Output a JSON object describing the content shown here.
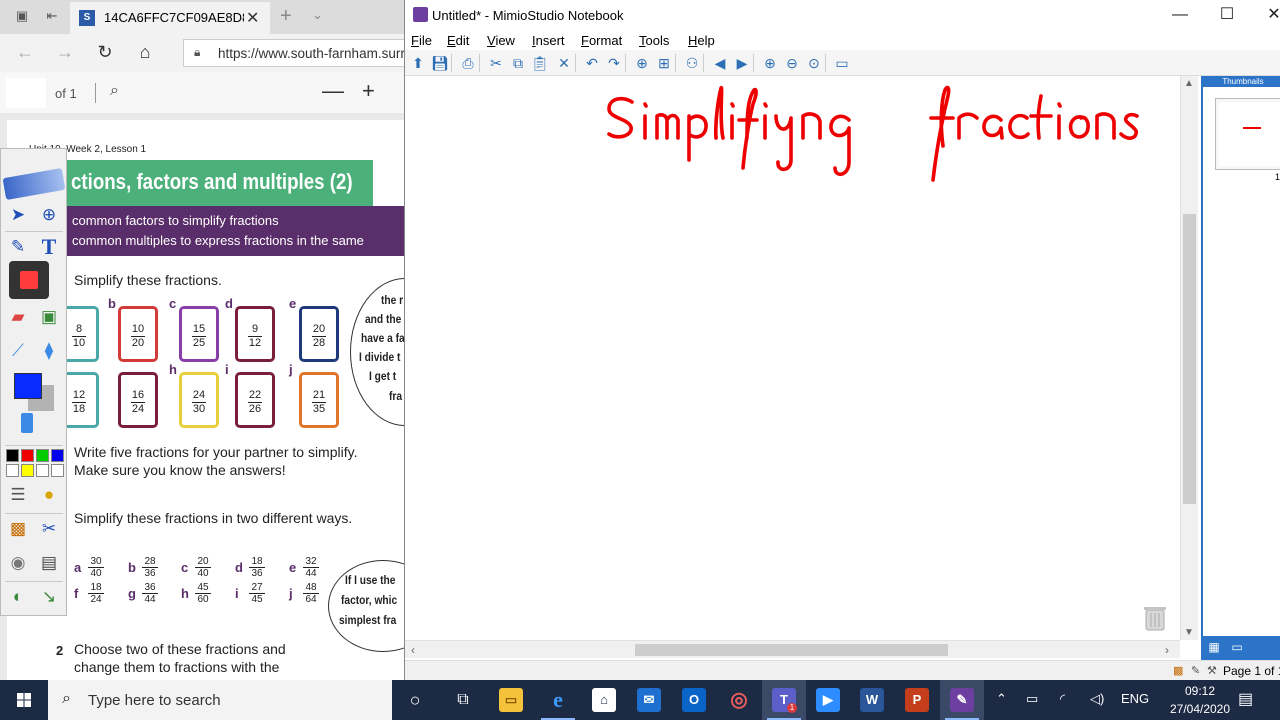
{
  "browser": {
    "tab_title": "14CA6FFC7CF09AE8D8I",
    "tab_favicon": "S",
    "url": "https://www.south-farnham.surr",
    "icons": {
      "back": "back-arrow-icon",
      "forward": "forward-arrow-icon",
      "refresh": "refresh-icon",
      "home": "home-icon",
      "lock": "lock-icon"
    },
    "pdf": {
      "page_of": "of 1",
      "unit": "Unit 10, Week 2, Lesson 1",
      "banner_title": "ctions, factors and multiples (2)",
      "objective_1": "common factors to simplify fractions",
      "objective_2": "common multiples to express fractions in the same",
      "q1_text": "Simplify these fractions.",
      "cards_row1": [
        {
          "letter": "",
          "num": "8",
          "den": "10",
          "color": "#4aa8a8"
        },
        {
          "letter": "b",
          "num": "10",
          "den": "20",
          "color": "#d33b3b"
        },
        {
          "letter": "c",
          "num": "15",
          "den": "25",
          "color": "#8a3fa8"
        },
        {
          "letter": "d",
          "num": "9",
          "den": "12",
          "color": "#7a1f3a"
        },
        {
          "letter": "e",
          "num": "20",
          "den": "28",
          "color": "#1f3a7a"
        }
      ],
      "cards_row2": [
        {
          "letter": "g",
          "num": "12",
          "den": "18",
          "color": "#4aa8a8"
        },
        {
          "letter": "",
          "num": "16",
          "den": "24",
          "color": "#7a1f3a"
        },
        {
          "letter": "h",
          "num": "24",
          "den": "30",
          "color": "#e6cf3a"
        },
        {
          "letter": "i",
          "num": "22",
          "den": "26",
          "color": "#7a1f3a"
        },
        {
          "letter": "j",
          "num": "21",
          "den": "35",
          "color": "#e0742a"
        }
      ],
      "bubble1_lines": [
        "the r",
        "and the",
        "have a fa",
        "I divide t",
        "I get t",
        "fra"
      ],
      "q_write_1": "Write five fractions for your partner to simplify.",
      "q_write_2": "Make sure you know the answers!",
      "q2_text": "Simplify these fractions in two different ways.",
      "row_a": [
        {
          "letter": "a",
          "num": "30",
          "den": "40"
        },
        {
          "letter": "b",
          "num": "28",
          "den": "36"
        },
        {
          "letter": "c",
          "num": "20",
          "den": "40"
        },
        {
          "letter": "d",
          "num": "18",
          "den": "36"
        },
        {
          "letter": "e",
          "num": "32",
          "den": "44"
        }
      ],
      "row_f": [
        {
          "letter": "f",
          "num": "18",
          "den": "24"
        },
        {
          "letter": "g",
          "num": "36",
          "den": "44"
        },
        {
          "letter": "h",
          "num": "45",
          "den": "60"
        },
        {
          "letter": "i",
          "num": "27",
          "den": "45"
        },
        {
          "letter": "j",
          "num": "48",
          "den": "64"
        }
      ],
      "bubble2_lines": [
        "If I use the",
        "factor, whic",
        "simplest fra"
      ],
      "q3_num": "2",
      "q3_line1": "Choose two of these fractions and",
      "q3_line2": "change them to fractions with the"
    }
  },
  "mimio": {
    "title": "Untitled* - MimioStudio Notebook",
    "menu": [
      {
        "label": "File",
        "key": "F"
      },
      {
        "label": "Edit",
        "key": "E"
      },
      {
        "label": "View",
        "key": "V"
      },
      {
        "label": "Insert",
        "key": "I"
      },
      {
        "label": "Format",
        "key": "F"
      },
      {
        "label": "Tools",
        "key": "T"
      },
      {
        "label": "Help",
        "key": "H"
      }
    ],
    "thumbs_header": "Thumbnails",
    "thumb_page_number": "1",
    "status_page": "Page 1 of 1",
    "handwriting_color": "#ee0000",
    "toolbar_icons": [
      "open-icon",
      "save-icon",
      "print-icon",
      "cut-icon",
      "copy-icon",
      "paste-icon",
      "delete-icon",
      "undo-icon",
      "redo-icon",
      "new-page-icon",
      "insert-page-icon",
      "collaborate-icon",
      "prev-page-icon",
      "next-page-icon",
      "zoom-in-icon",
      "zoom-out-icon",
      "zoom-fit-icon",
      "screen-icon"
    ]
  },
  "taskbar": {
    "search_placeholder": "Type here to search",
    "lang": "ENG",
    "time": "09:12",
    "date": "27/04/2020",
    "teams_badge": "1"
  },
  "colors": {
    "accent": "#2b74c8",
    "taskbar": "#1c2a44",
    "pen_blue": "#0a2bff",
    "ink_red": "#ee0000"
  }
}
